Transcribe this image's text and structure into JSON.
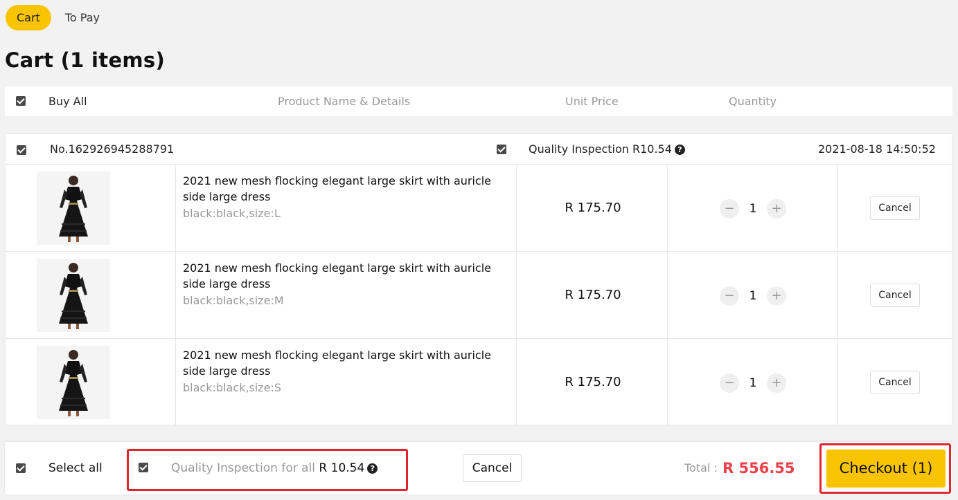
{
  "tabs": [
    {
      "label": "Cart",
      "active": true
    },
    {
      "label": "To Pay",
      "active": false
    }
  ],
  "page_title": "Cart (1 items)",
  "table_header": {
    "buy_all": "Buy All",
    "product": "Product Name & Details",
    "unit_price": "Unit Price",
    "quantity": "Quantity"
  },
  "order": {
    "number": "No.162926945288791",
    "quality_inspection": "Quality Inspection R10.54",
    "timestamp": "2021-08-18 14:50:52",
    "items": [
      {
        "name": "2021 new mesh flocking elegant large skirt with auricle side large dress",
        "variant": "black:black,size:L",
        "price": "R 175.70",
        "qty": "1",
        "cancel": "Cancel"
      },
      {
        "name": "2021 new mesh flocking elegant large skirt with auricle side large dress",
        "variant": "black:black,size:M",
        "price": "R 175.70",
        "qty": "1",
        "cancel": "Cancel"
      },
      {
        "name": "2021 new mesh flocking elegant large skirt with auricle side large dress",
        "variant": "black:black,size:S",
        "price": "R 175.70",
        "qty": "1",
        "cancel": "Cancel"
      }
    ]
  },
  "footer": {
    "select_all": "Select all",
    "qi_label": "Quality Inspection for all",
    "qi_amount": "R 10.54",
    "cancel": "Cancel",
    "total_label": "Total :",
    "total_value": "R 556.55",
    "checkout": "Checkout (1)"
  },
  "icons": {
    "question": "question-icon",
    "minus": "minus-icon",
    "plus": "plus-icon",
    "checkbox": "checkbox-checked-icon"
  },
  "colors": {
    "accent": "#f8c300",
    "total": "#e8434b",
    "highlight": "#e0252e"
  }
}
